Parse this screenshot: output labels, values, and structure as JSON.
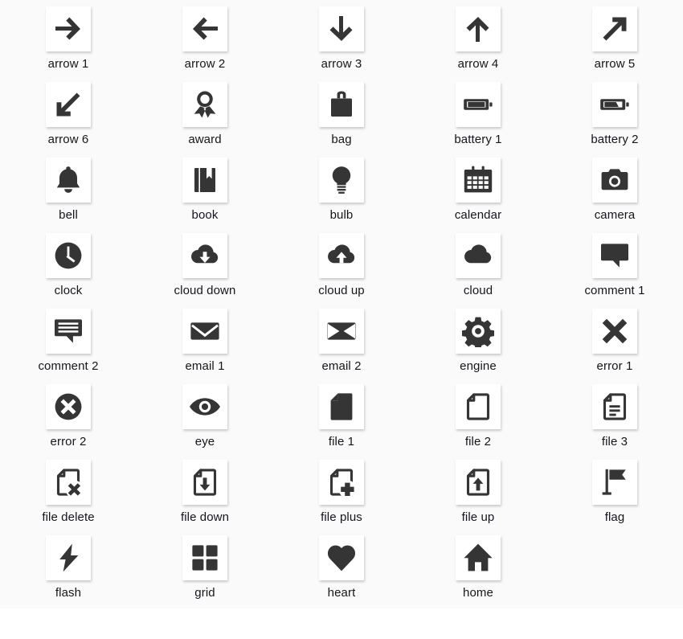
{
  "panel": {
    "background": "#fafafa",
    "icon_color": "#353535",
    "label_color": "#15161c",
    "columns": 5
  },
  "icons": [
    {
      "label": "arrow 1",
      "name": "arrow-right-icon",
      "glyph": "arrow-right"
    },
    {
      "label": "arrow 2",
      "name": "arrow-left-icon",
      "glyph": "arrow-left"
    },
    {
      "label": "arrow 3",
      "name": "arrow-down-icon",
      "glyph": "arrow-down"
    },
    {
      "label": "arrow 4",
      "name": "arrow-up-icon",
      "glyph": "arrow-up"
    },
    {
      "label": "arrow 5",
      "name": "arrow-up-right-icon",
      "glyph": "arrow-up-right"
    },
    {
      "label": "arrow 6",
      "name": "arrow-down-left-icon",
      "glyph": "arrow-down-left"
    },
    {
      "label": "award",
      "name": "award-icon",
      "glyph": "award"
    },
    {
      "label": "bag",
      "name": "bag-icon",
      "glyph": "bag"
    },
    {
      "label": "battery 1",
      "name": "battery-full-icon",
      "glyph": "battery-full"
    },
    {
      "label": "battery 2",
      "name": "battery-half-icon",
      "glyph": "battery-half"
    },
    {
      "label": "bell",
      "name": "bell-icon",
      "glyph": "bell"
    },
    {
      "label": "book",
      "name": "book-icon",
      "glyph": "book"
    },
    {
      "label": "bulb",
      "name": "bulb-icon",
      "glyph": "bulb"
    },
    {
      "label": "calendar",
      "name": "calendar-icon",
      "glyph": "calendar"
    },
    {
      "label": "camera",
      "name": "camera-icon",
      "glyph": "camera"
    },
    {
      "label": "clock",
      "name": "clock-icon",
      "glyph": "clock"
    },
    {
      "label": "cloud down",
      "name": "cloud-download-icon",
      "glyph": "cloud-down"
    },
    {
      "label": "cloud up",
      "name": "cloud-upload-icon",
      "glyph": "cloud-up"
    },
    {
      "label": "cloud",
      "name": "cloud-icon",
      "glyph": "cloud"
    },
    {
      "label": "comment 1",
      "name": "comment-bubble-icon",
      "glyph": "comment-1"
    },
    {
      "label": "comment 2",
      "name": "comment-lines-icon",
      "glyph": "comment-2"
    },
    {
      "label": "email 1",
      "name": "email-closed-icon",
      "glyph": "email-1"
    },
    {
      "label": "email 2",
      "name": "email-open-icon",
      "glyph": "email-2"
    },
    {
      "label": "engine",
      "name": "gear-icon",
      "glyph": "engine"
    },
    {
      "label": "error 1",
      "name": "close-x-icon",
      "glyph": "error-1"
    },
    {
      "label": "error 2",
      "name": "error-circle-icon",
      "glyph": "error-2"
    },
    {
      "label": "eye",
      "name": "eye-icon",
      "glyph": "eye"
    },
    {
      "label": "file 1",
      "name": "file-solid-icon",
      "glyph": "file-1"
    },
    {
      "label": "file 2",
      "name": "file-outline-icon",
      "glyph": "file-2"
    },
    {
      "label": "file 3",
      "name": "file-text-icon",
      "glyph": "file-3"
    },
    {
      "label": "file delete",
      "name": "file-delete-icon",
      "glyph": "file-delete"
    },
    {
      "label": "file down",
      "name": "file-download-icon",
      "glyph": "file-down"
    },
    {
      "label": "file plus",
      "name": "file-plus-icon",
      "glyph": "file-plus"
    },
    {
      "label": "file up",
      "name": "file-upload-icon",
      "glyph": "file-up"
    },
    {
      "label": "flag",
      "name": "flag-icon",
      "glyph": "flag"
    },
    {
      "label": "flash",
      "name": "flash-icon",
      "glyph": "flash"
    },
    {
      "label": "grid",
      "name": "grid-icon",
      "glyph": "grid"
    },
    {
      "label": "heart",
      "name": "heart-icon",
      "glyph": "heart"
    },
    {
      "label": "home",
      "name": "home-icon",
      "glyph": "home"
    }
  ]
}
